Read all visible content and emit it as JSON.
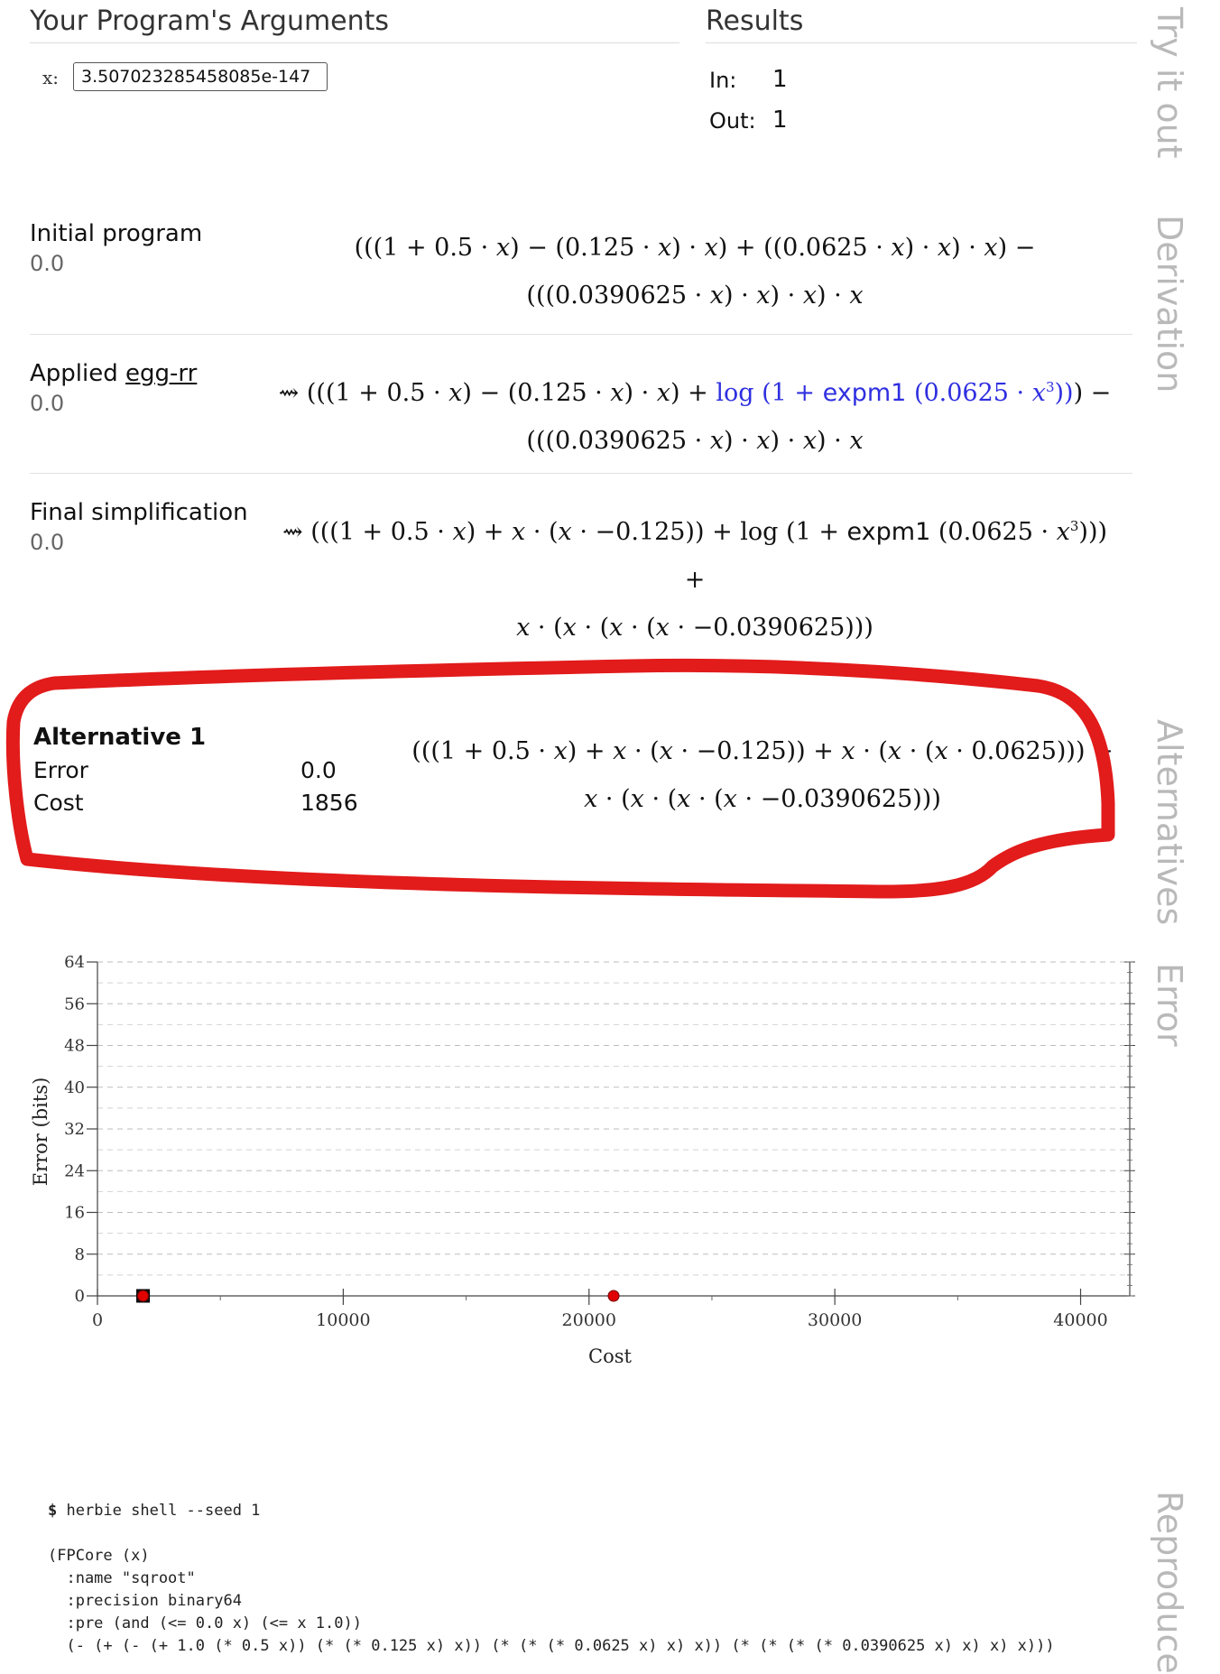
{
  "args": {
    "title": "Your Program's Arguments",
    "var_label": "x:",
    "x_value": "3.507023285458085e-147"
  },
  "results": {
    "title": "Results",
    "in_label": "In:",
    "in_value": "1",
    "out_label": "Out:",
    "out_value": "1"
  },
  "side_tabs": [
    "Try it out",
    "Derivation",
    "Alternatives",
    "Error",
    "Reproduce"
  ],
  "derivation": {
    "initial": {
      "title": "Initial program",
      "error": "0.0"
    },
    "applied": {
      "title_prefix": "Applied",
      "link": "egg-rr",
      "error": "0.0"
    },
    "final": {
      "title": "Final simplification",
      "error": "0.0"
    }
  },
  "alternative": {
    "title": "Alternative 1",
    "error_label": "Error",
    "error_value": "0.0",
    "cost_label": "Cost",
    "cost_value": "1856"
  },
  "chart_data": {
    "type": "scatter",
    "xlabel": "Cost",
    "ylabel": "Error (bits)",
    "xlim": [
      0,
      42000
    ],
    "ylim": [
      0,
      64
    ],
    "xticks": [
      0,
      10000,
      20000,
      30000,
      40000
    ],
    "yticks": [
      0,
      8,
      16,
      24,
      32,
      40,
      48,
      56,
      64
    ],
    "grid": "horizontal-dashed",
    "points": [
      {
        "x": 1856,
        "y": 0,
        "marker": "square"
      },
      {
        "x": 1856,
        "y": 0,
        "marker": "circle",
        "color": "#e00000"
      },
      {
        "x": 21000,
        "y": 0,
        "marker": "circle",
        "color": "#e00000"
      }
    ]
  },
  "reproduce": {
    "lines": [
      "(FPCore (x)",
      "  :name \"sqroot\"",
      "  :precision binary64",
      "  :pre (and (<= 0.0 x) (<= x 1.0))",
      "  (- (+ (- (+ 1.0 (* 0.5 x)) (* (* 0.125 x) x)) (* (* (* 0.0625 x) x) x)) (* (* (* (* 0.0390625 x) x) x) x)))"
    ],
    "prompt": "$",
    "command": " herbie shell --seed 1"
  }
}
